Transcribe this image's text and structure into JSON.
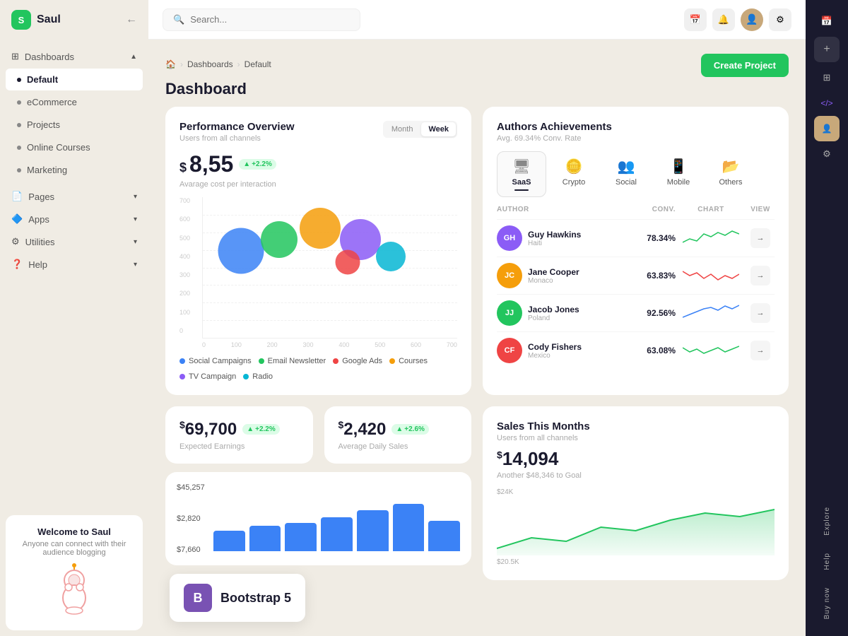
{
  "app": {
    "name": "Saul",
    "logo_letter": "S"
  },
  "sidebar": {
    "items": [
      {
        "id": "dashboards",
        "label": "Dashboards",
        "type": "section",
        "has_arrow": true,
        "icon": "grid"
      },
      {
        "id": "default",
        "label": "Default",
        "type": "child",
        "active": true
      },
      {
        "id": "ecommerce",
        "label": "eCommerce",
        "type": "child"
      },
      {
        "id": "projects",
        "label": "Projects",
        "type": "child"
      },
      {
        "id": "online-courses",
        "label": "Online Courses",
        "type": "child"
      },
      {
        "id": "marketing",
        "label": "Marketing",
        "type": "child"
      },
      {
        "id": "pages",
        "label": "Pages",
        "type": "section",
        "has_arrow": true,
        "icon": "pages"
      },
      {
        "id": "apps",
        "label": "Apps",
        "type": "section",
        "has_arrow": true,
        "icon": "apps"
      },
      {
        "id": "utilities",
        "label": "Utilities",
        "type": "section",
        "has_arrow": true,
        "icon": "utilities"
      },
      {
        "id": "help",
        "label": "Help",
        "type": "section",
        "has_arrow": true,
        "icon": "help"
      }
    ],
    "bottom": {
      "title": "Welcome to Saul",
      "subtitle": "Anyone can connect with their audience blogging"
    }
  },
  "topbar": {
    "search_placeholder": "Search...",
    "search_label": "Search _"
  },
  "breadcrumb": {
    "home": "🏠",
    "dashboards": "Dashboards",
    "current": "Default"
  },
  "page_title": "Dashboard",
  "create_btn": "Create Project",
  "performance": {
    "title": "Performance Overview",
    "subtitle": "Users from all channels",
    "tab_month": "Month",
    "tab_week": "Week",
    "metric_value": "8,55",
    "metric_currency": "$",
    "metric_badge": "+2.2%",
    "metric_label": "Avarage cost per interaction",
    "y_labels": [
      "700",
      "600",
      "500",
      "400",
      "300",
      "200",
      "100",
      "0"
    ],
    "x_labels": [
      "0",
      "100",
      "200",
      "300",
      "400",
      "500",
      "600",
      "700"
    ],
    "bubbles": [
      {
        "x": 18,
        "y": 45,
        "size": 65,
        "color": "#3b82f6"
      },
      {
        "x": 32,
        "y": 38,
        "size": 52,
        "color": "#22c55e"
      },
      {
        "x": 47,
        "y": 30,
        "size": 56,
        "color": "#f59e0b"
      },
      {
        "x": 62,
        "y": 38,
        "size": 58,
        "color": "#8b5cf6"
      },
      {
        "x": 57,
        "y": 47,
        "size": 35,
        "color": "#ef4444"
      },
      {
        "x": 73,
        "y": 44,
        "size": 40,
        "color": "#06b6d4"
      }
    ],
    "legend": [
      {
        "label": "Social Campaigns",
        "color": "#3b82f6"
      },
      {
        "label": "Email Newsletter",
        "color": "#22c55e"
      },
      {
        "label": "Google Ads",
        "color": "#ef4444"
      },
      {
        "label": "Courses",
        "color": "#f59e0b"
      },
      {
        "label": "TV Campaign",
        "color": "#8b5cf6"
      },
      {
        "label": "Radio",
        "color": "#06b6d4"
      }
    ]
  },
  "authors": {
    "title": "Authors Achievements",
    "subtitle": "Avg. 69.34% Conv. Rate",
    "tabs": [
      {
        "id": "saas",
        "label": "SaaS",
        "icon": "🖥",
        "active": true
      },
      {
        "id": "crypto",
        "label": "Crypto",
        "icon": "🪙"
      },
      {
        "id": "social",
        "label": "Social",
        "icon": "👥"
      },
      {
        "id": "mobile",
        "label": "Mobile",
        "icon": "📱"
      },
      {
        "id": "others",
        "label": "Others",
        "icon": "📂"
      }
    ],
    "col_author": "AUTHOR",
    "col_conv": "CONV.",
    "col_chart": "CHART",
    "col_view": "VIEW",
    "rows": [
      {
        "name": "Guy Hawkins",
        "country": "Haiti",
        "conv": "78.34%",
        "chart_color": "#22c55e",
        "avatar_bg": "#8b5cf6",
        "initials": "GH"
      },
      {
        "name": "Jane Cooper",
        "country": "Monaco",
        "conv": "63.83%",
        "chart_color": "#ef4444",
        "avatar_bg": "#f59e0b",
        "initials": "JC"
      },
      {
        "name": "Jacob Jones",
        "country": "Poland",
        "conv": "92.56%",
        "chart_color": "#3b82f6",
        "avatar_bg": "#22c55e",
        "initials": "JJ"
      },
      {
        "name": "Cody Fishers",
        "country": "Mexico",
        "conv": "63.08%",
        "chart_color": "#22c55e",
        "avatar_bg": "#ef4444",
        "initials": "CF"
      }
    ]
  },
  "earnings": {
    "currency": "$",
    "value": "69,700",
    "badge": "+2.2%",
    "label": "Expected Earnings"
  },
  "daily_sales": {
    "currency": "$",
    "value": "2,420",
    "badge": "+2.6%",
    "label": "Average Daily Sales"
  },
  "sales_months": {
    "title": "Sales This Months",
    "subtitle": "Users from all channels",
    "currency": "$",
    "value": "14,094",
    "goal_text": "Another $48,346 to Goal",
    "y_labels": [
      "$24K",
      "$20.5K"
    ],
    "bar_values": [
      7660,
      2820,
      45257
    ],
    "bar_amounts": [
      "$7,660",
      "$2,820",
      "$45,257"
    ]
  },
  "right_panel": {
    "labels": [
      "Explore",
      "Help",
      "Buy now"
    ]
  },
  "bootstrap": {
    "letter": "B",
    "text": "Bootstrap 5"
  }
}
